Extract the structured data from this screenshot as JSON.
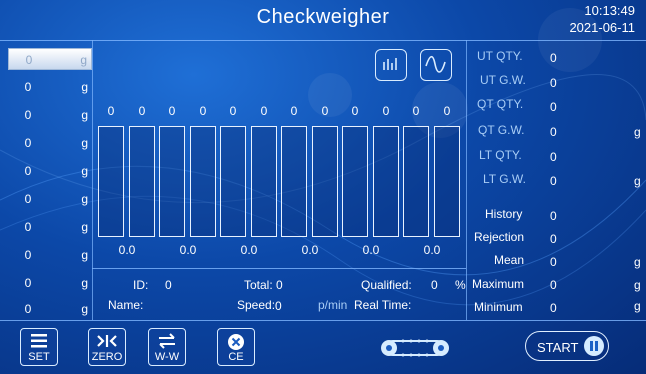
{
  "header": {
    "title": "Checkweigher",
    "time": "10:13:49",
    "date": "2021-06-11"
  },
  "left_list": {
    "unit": "g",
    "values": [
      "0",
      "0",
      "0",
      "0",
      "0",
      "0",
      "0",
      "0",
      "0",
      "0"
    ]
  },
  "bars": {
    "top_values": [
      "0",
      "0",
      "0",
      "0",
      "0",
      "0",
      "0",
      "0",
      "0",
      "0",
      "0",
      "0"
    ],
    "bottom_labels": [
      "0.0",
      "0.0",
      "0.0",
      "0.0",
      "0.0",
      "0.0"
    ]
  },
  "info": {
    "id_label": "ID:",
    "id_value": "0",
    "total_label": "Total:",
    "total_value": "0",
    "qualified_label": "Qualified:",
    "qualified_value": "0",
    "qualified_unit": "%",
    "name_label": "Name:",
    "speed_label": "Speed:",
    "speed_value": "0",
    "speed_unit": "p/min",
    "realtime_label": "Real Time:"
  },
  "stats": {
    "ut_qty": {
      "label": "UT QTY.",
      "value": "0"
    },
    "ut_gw": {
      "label": "UT G.W.",
      "value": "0"
    },
    "qt_qty": {
      "label": "QT QTY.",
      "value": "0"
    },
    "qt_gw": {
      "label": "QT G.W.",
      "value": "0",
      "unit": "g"
    },
    "lt_qty": {
      "label": "LT QTY.",
      "value": "0"
    },
    "lt_gw": {
      "label": "LT G.W.",
      "value": "0",
      "unit": "g"
    },
    "history": {
      "label": "History",
      "value": "0"
    },
    "rejection": {
      "label": "Rejection",
      "value": "0"
    },
    "mean": {
      "label": "Mean",
      "value": "0",
      "unit": "g"
    },
    "maximum": {
      "label": "Maximum",
      "value": "0",
      "unit": "g"
    },
    "minimum": {
      "label": "Minimum",
      "value": "0",
      "unit": "g"
    }
  },
  "toolbar": {
    "set": "SET",
    "zero": "ZERO",
    "ww": "W-W",
    "ce": "CE",
    "start": "START"
  },
  "icons": [
    "bar-chart-icon",
    "wave-chart-icon",
    "menu-icon",
    "zero-icon",
    "swap-icon",
    "close-circle-icon",
    "conveyor-icon",
    "pause-icon"
  ],
  "colors": {
    "background": "#0c48a8",
    "accent": "#d6ecff",
    "dim_label": "#a8cdf6"
  }
}
